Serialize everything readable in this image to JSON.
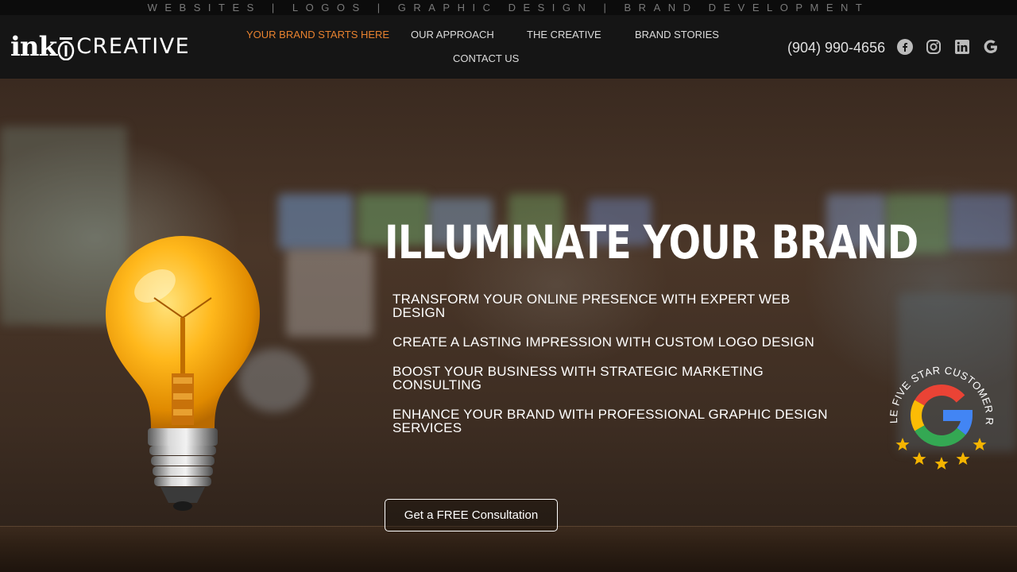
{
  "tagline": "WEBSITES | LOGOS | GRAPHIC DESIGN | BRAND DEVELOPMENT",
  "logo": {
    "ink": "ink",
    "creative": "CREATIVE"
  },
  "nav": {
    "items": [
      {
        "label": "YOUR BRAND STARTS HERE",
        "active": true
      },
      {
        "label": "OUR APPROACH"
      },
      {
        "label": "THE CREATIVE"
      },
      {
        "label": "BRAND STORIES"
      },
      {
        "label": "CONTACT US"
      }
    ]
  },
  "phone": "(904) 990-4656",
  "social": [
    "facebook-icon",
    "instagram-icon",
    "linkedin-icon",
    "google-icon"
  ],
  "hero": {
    "title": "ILLUMINATE YOUR BRAND",
    "services": [
      "TRANSFORM YOUR ONLINE PRESENCE WITH EXPERT WEB DESIGN",
      "CREATE A LASTING IMPRESSION WITH CUSTOM LOGO DESIGN",
      "BOOST YOUR BUSINESS WITH STRATEGIC MARKETING CONSULTING",
      "ENHANCE YOUR BRAND WITH PROFESSIONAL GRAPHIC DESIGN SERVICES"
    ],
    "cta_label": "Get a FREE Consultation",
    "badge_text": "GOOGLE FIVE STAR CUSTOMER RATED!"
  },
  "colors": {
    "accent": "#e8822f",
    "header_bg": "#151515",
    "text": "#ffffff"
  }
}
